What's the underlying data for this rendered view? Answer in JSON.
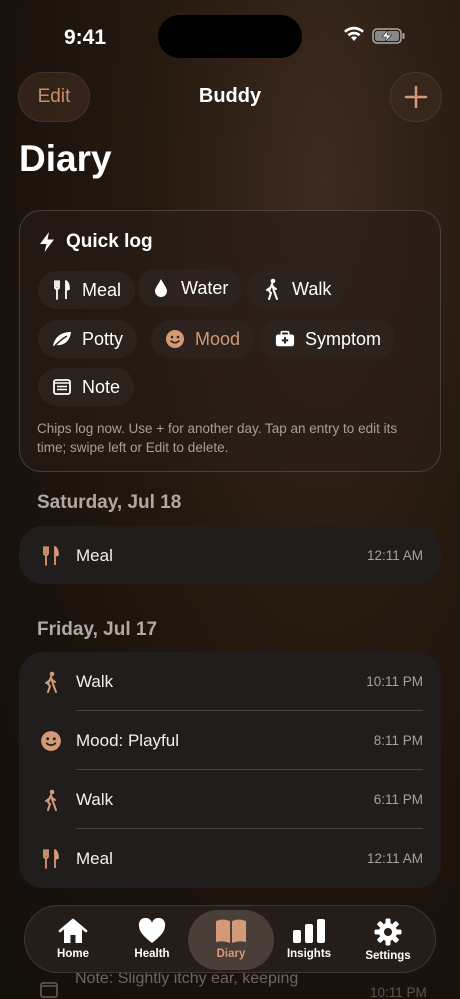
{
  "status": {
    "time": "9:41"
  },
  "nav": {
    "edit_label": "Edit",
    "title": "Buddy"
  },
  "page": {
    "title": "Diary"
  },
  "quick_log": {
    "title": "Quick log",
    "chips": [
      {
        "label": "Meal",
        "icon": "fork-knife-icon"
      },
      {
        "label": "Water",
        "icon": "drop-icon"
      },
      {
        "label": "Walk",
        "icon": "walk-icon"
      },
      {
        "label": "Potty",
        "icon": "leaf-icon"
      },
      {
        "label": "Mood",
        "icon": "smile-icon"
      },
      {
        "label": "Symptom",
        "icon": "medkit-icon"
      },
      {
        "label": "Note",
        "icon": "note-icon"
      }
    ],
    "help": "Chips log now. Use + for another day. Tap an entry to edit its time; swipe left or Edit to delete."
  },
  "days": [
    {
      "date": "Saturday, Jul 18",
      "entries": [
        {
          "label": "Meal",
          "time": "12:11 AM",
          "icon": "fork-knife-icon"
        }
      ]
    },
    {
      "date": "Friday, Jul 17",
      "entries": [
        {
          "label": "Walk",
          "time": "10:11 PM",
          "icon": "walk-icon"
        },
        {
          "label": "Mood: Playful",
          "time": "8:11 PM",
          "icon": "smile-icon"
        },
        {
          "label": "Walk",
          "time": "6:11 PM",
          "icon": "walk-icon"
        },
        {
          "label": "Meal",
          "time": "12:11 AM",
          "icon": "fork-knife-icon"
        }
      ]
    }
  ],
  "peek": {
    "text": "Note: Slightly itchy ear, keeping",
    "time": "10:11 PM"
  },
  "tabs": [
    {
      "label": "Home",
      "icon": "house-icon"
    },
    {
      "label": "Health",
      "icon": "heart-icon"
    },
    {
      "label": "Diary",
      "icon": "book-icon",
      "active": true
    },
    {
      "label": "Insights",
      "icon": "bars-icon"
    },
    {
      "label": "Settings",
      "icon": "gear-icon"
    }
  ],
  "colors": {
    "accent": "#d49a78",
    "card": "#201d1c"
  }
}
